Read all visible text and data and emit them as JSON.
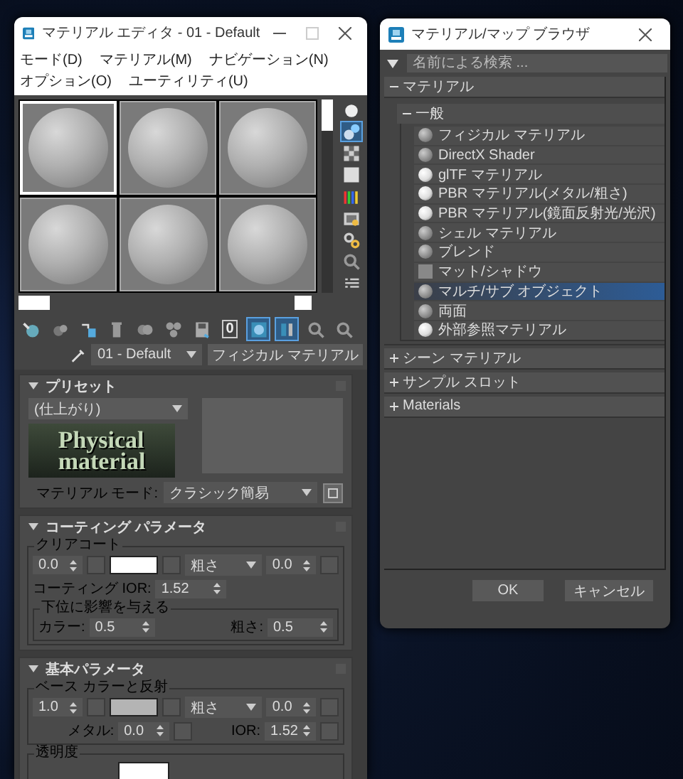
{
  "editor": {
    "title": "マテリアル エディタ - 01 - Default",
    "menu": [
      "モード(D)",
      "マテリアル(M)",
      "ナビゲーション(N)",
      "オプション(O)",
      "ユーティリティ(U)"
    ],
    "slots": [
      {
        "selected": true
      },
      {
        "selected": false
      },
      {
        "selected": false
      },
      {
        "selected": false
      },
      {
        "selected": false
      },
      {
        "selected": false
      }
    ],
    "side_tools": [
      {
        "kind": "sphere",
        "on": false
      },
      {
        "kind": "backlight",
        "on": true
      },
      {
        "kind": "pattern",
        "on": false
      },
      {
        "kind": "box",
        "on": false
      },
      {
        "kind": "colors",
        "on": false
      },
      {
        "kind": "video",
        "on": false
      },
      {
        "kind": "options",
        "on": false
      },
      {
        "kind": "magnify",
        "on": false
      },
      {
        "kind": "list",
        "on": false
      }
    ],
    "tools": [
      {
        "kind": "get",
        "on": false
      },
      {
        "kind": "put",
        "on": false
      },
      {
        "kind": "assign",
        "on": false
      },
      {
        "kind": "delete",
        "on": false
      },
      {
        "kind": "copy",
        "on": false
      },
      {
        "kind": "unique",
        "on": false
      },
      {
        "kind": "save",
        "on": false
      },
      {
        "kind": "id",
        "label": "0",
        "on": false
      },
      {
        "kind": "map",
        "on": true
      },
      {
        "kind": "result",
        "on": true
      },
      {
        "kind": "parent",
        "on": false
      },
      {
        "kind": "sibling",
        "on": false
      }
    ],
    "material_name": "01 - Default",
    "material_type": "フィジカル マテリアル",
    "presets": {
      "title": "プリセット",
      "expanded": true,
      "preset": "(仕上がり)",
      "logo": [
        "Physical",
        "material"
      ],
      "mode_label": "マテリアル モード:",
      "mode": "クラシック簡易"
    },
    "coating": {
      "title": "コーティング パラメータ",
      "expanded": true,
      "group": "クリアコート",
      "weight": "0.0",
      "color": "#ffffff",
      "rough_mode": "粗さ",
      "roughness": "0.0",
      "ior_label": "コーティング IOR:",
      "ior": "1.52",
      "sub_group": "下位に影響を与える",
      "color_label": "カラー:",
      "color_value": "0.5",
      "rough_label": "粗さ:",
      "rough_value": "0.5"
    },
    "basic": {
      "title": "基本パラメータ",
      "expanded": true,
      "group": "ベース カラーと反射",
      "weight": "1.0",
      "color": "#b4b4b4",
      "rough_mode": "粗さ",
      "roughness": "0.0",
      "metal_label": "メタル:",
      "metal": "0.0",
      "ior_label": "IOR:",
      "ior": "1.52",
      "next_group": "透明度"
    }
  },
  "browser": {
    "title": "マテリアル/マップ ブラウザ",
    "search_placeholder": "名前による検索 ...",
    "tree": [
      {
        "label": "マテリアル",
        "expanded": true,
        "children": [
          {
            "label": "一般",
            "expanded": true,
            "children": [
              {
                "label": "フィジカル マテリアル",
                "kind": "gray",
                "selected": false
              },
              {
                "label": "DirectX Shader",
                "kind": "gray",
                "selected": false
              },
              {
                "label": "glTF マテリアル",
                "kind": "white",
                "selected": false
              },
              {
                "label": "PBR マテリアル(メタル/粗さ)",
                "kind": "white",
                "selected": false
              },
              {
                "label": "PBR マテリアル(鏡面反射光/光沢)",
                "kind": "white",
                "selected": false
              },
              {
                "label": "シェル マテリアル",
                "kind": "gray",
                "selected": false
              },
              {
                "label": "ブレンド",
                "kind": "gray",
                "selected": false
              },
              {
                "label": "マット/シャドウ",
                "kind": "flat",
                "selected": false
              },
              {
                "label": "マルチ/サブ オブジェクト",
                "kind": "gray",
                "selected": true
              },
              {
                "label": "両面",
                "kind": "gray",
                "selected": false
              },
              {
                "label": "外部参照マテリアル",
                "kind": "white",
                "selected": false
              }
            ]
          }
        ]
      },
      {
        "label": "シーン マテリアル",
        "expanded": false
      },
      {
        "label": "サンプル スロット",
        "expanded": false
      },
      {
        "label": "Materials",
        "expanded": false
      }
    ],
    "buttons": [
      "OK",
      "キャンセル"
    ]
  }
}
